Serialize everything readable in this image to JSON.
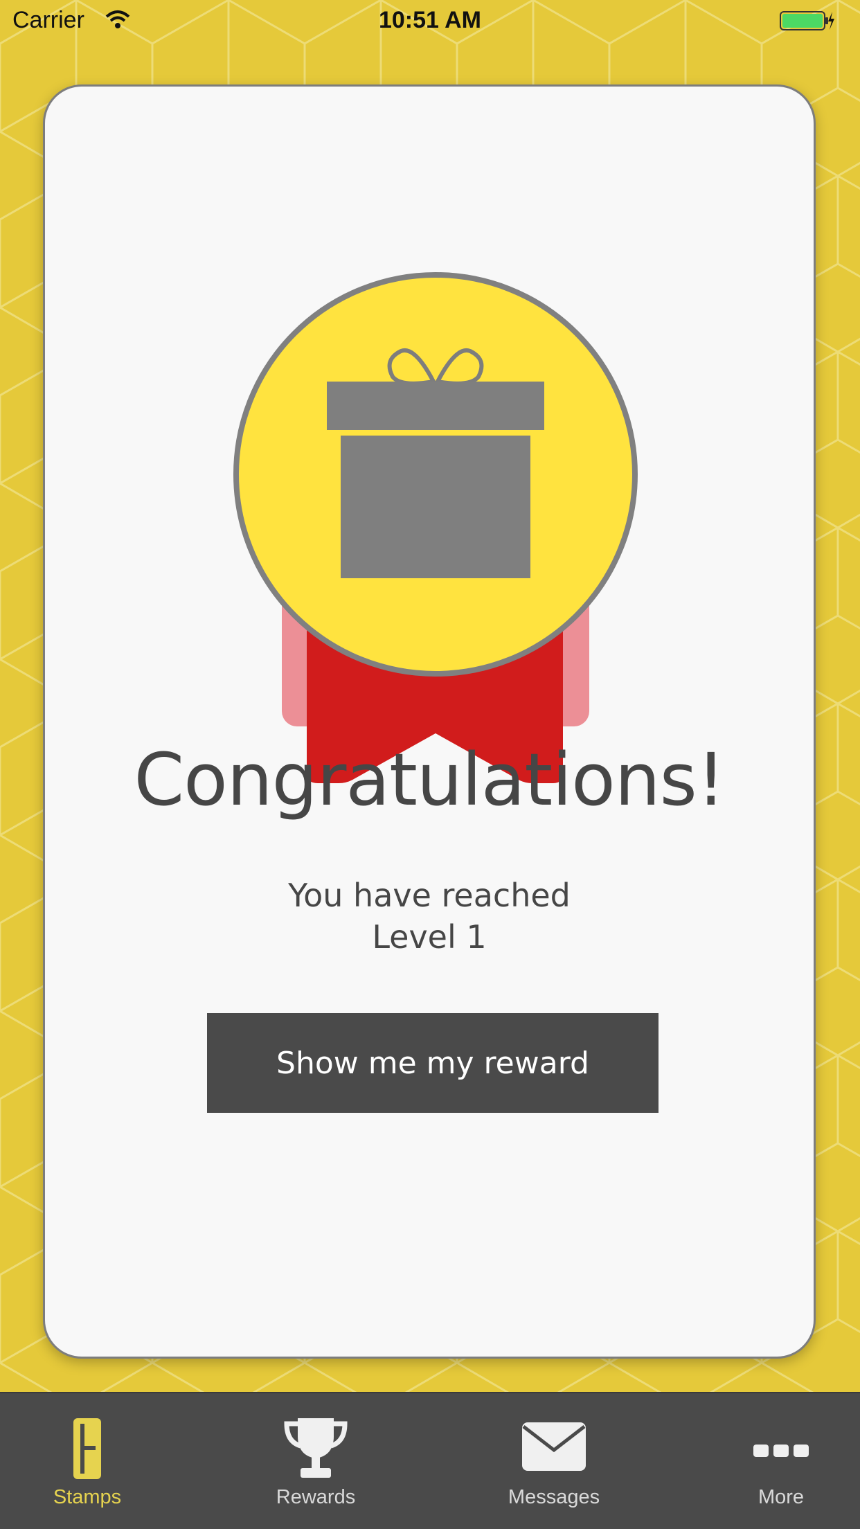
{
  "status_bar": {
    "carrier": "Carrier",
    "time": "10:51 AM"
  },
  "card": {
    "title": "Congratulations!",
    "message_line1": "You have reached",
    "message_line2": "Level 1",
    "button_label": "Show me my reward"
  },
  "tabs": [
    {
      "label": "Stamps",
      "icon": "stamps-icon",
      "active": true
    },
    {
      "label": "Rewards",
      "icon": "trophy-icon",
      "active": false
    },
    {
      "label": "Messages",
      "icon": "envelope-icon",
      "active": false
    },
    {
      "label": "More",
      "icon": "more-dots-icon",
      "active": false
    }
  ],
  "colors": {
    "background": "#e5c93a",
    "card": "#f8f8f8",
    "medal": "#ffe33f",
    "ribbon": "#d11c1c",
    "button": "#4a4a4a",
    "active_tab": "#e6d34f"
  }
}
